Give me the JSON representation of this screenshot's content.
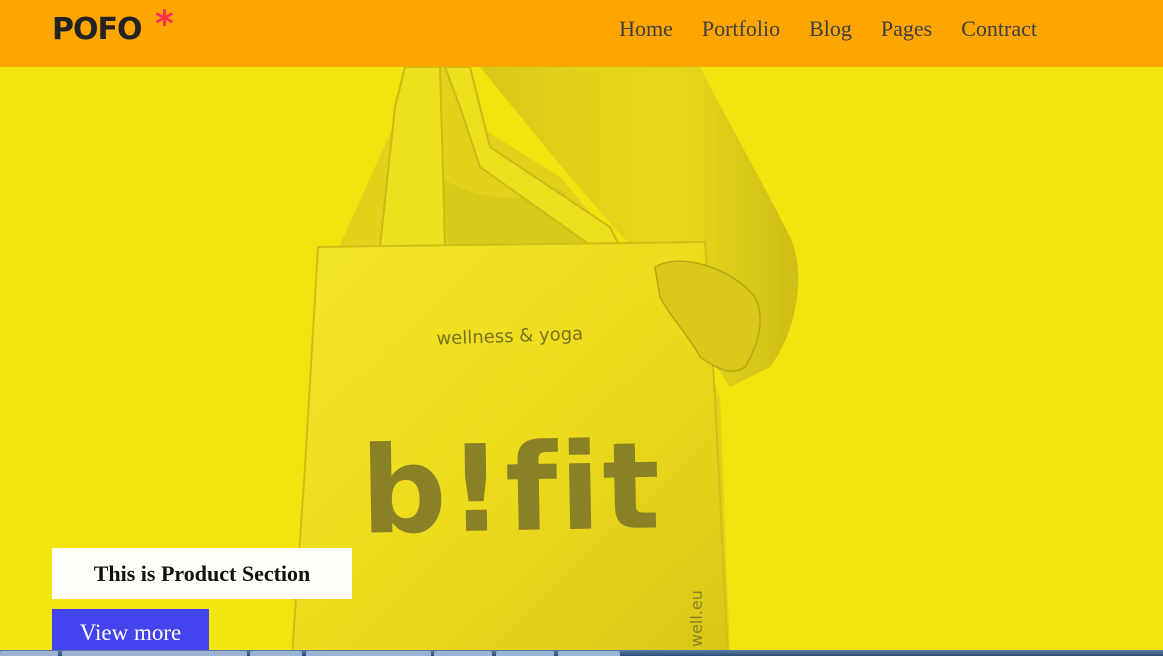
{
  "header": {
    "logo_text": "POFO",
    "logo_star": "*",
    "nav": [
      {
        "label": "Home"
      },
      {
        "label": "Portfolio"
      },
      {
        "label": "Blog"
      },
      {
        "label": "Pages"
      },
      {
        "label": "Contract"
      }
    ],
    "colors": {
      "bar": "#ffa500",
      "logo": "#232323",
      "star": "#ff2f54",
      "nav_text": "#3e3e3e"
    }
  },
  "hero": {
    "background": "#f2e40f",
    "bag_text_small": "wellness & yoga",
    "bag_text_big": "b!fit",
    "bag_side_text": "well.eu"
  },
  "product": {
    "heading": "This is Product Section",
    "button_label": "View more",
    "button_color": "#4444ee"
  }
}
